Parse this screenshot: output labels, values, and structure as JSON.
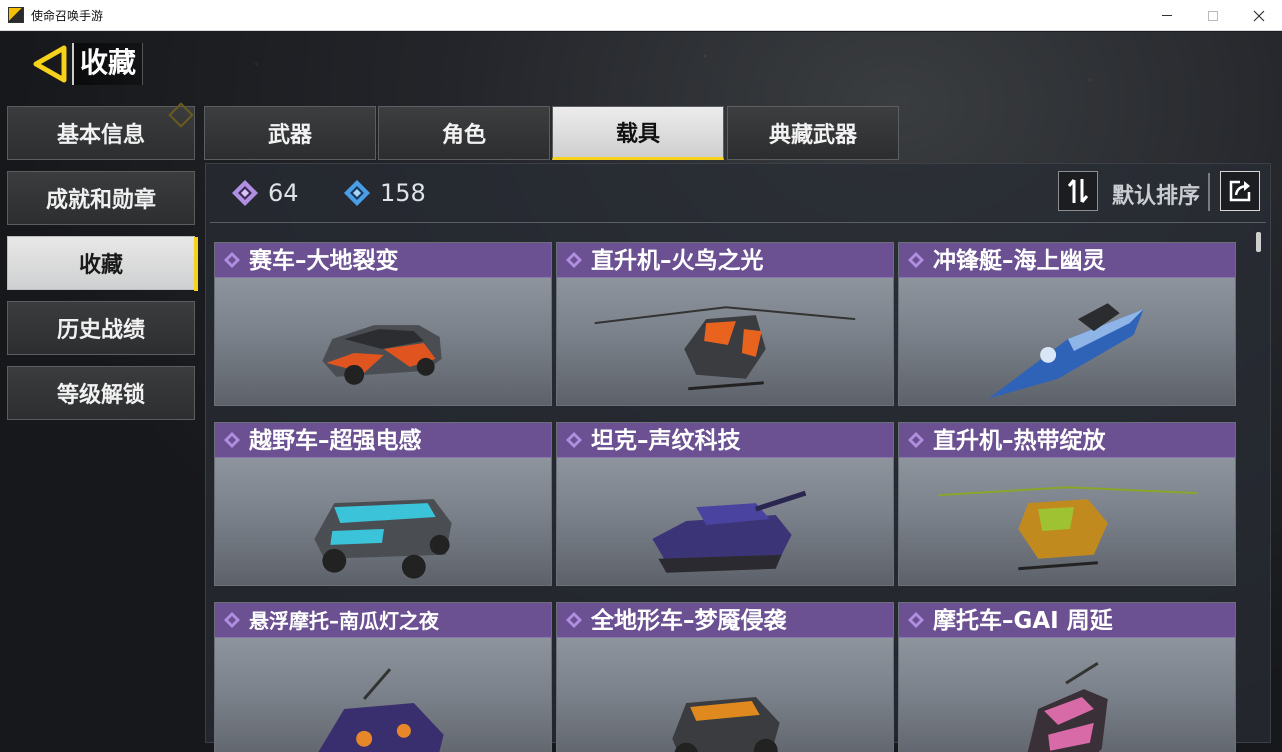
{
  "window": {
    "title": "使命召唤手游"
  },
  "header": {
    "title": "收藏"
  },
  "sidebar": {
    "items": [
      {
        "label": "基本信息"
      },
      {
        "label": "成就和勋章"
      },
      {
        "label": "收藏"
      },
      {
        "label": "历史战绩"
      },
      {
        "label": "等级解锁"
      }
    ],
    "active_index": 2
  },
  "tabs": {
    "items": [
      {
        "label": "武器"
      },
      {
        "label": "角色"
      },
      {
        "label": "载具"
      },
      {
        "label": "典藏武器"
      }
    ],
    "active_index": 2
  },
  "stats": {
    "purple_count": "64",
    "blue_count": "158"
  },
  "toolbar": {
    "sort_label": "默认排序",
    "sort_icon": "sort-updown-icon",
    "share_icon": "share-icon"
  },
  "colors": {
    "accent_yellow": "#f6d21b",
    "card_header_purple": "#6b5192",
    "rarity_purple": "#b08ee0",
    "rarity_blue": "#4a9ee8"
  },
  "cards": [
    {
      "title": "赛车–大地裂变",
      "art": "race-car-icon"
    },
    {
      "title": "直升机–火鸟之光",
      "art": "helicopter-icon"
    },
    {
      "title": "冲锋艇–海上幽灵",
      "art": "speedboat-icon"
    },
    {
      "title": "越野车–超强电感",
      "art": "offroad-car-icon"
    },
    {
      "title": "坦克–声纹科技",
      "art": "tank-icon"
    },
    {
      "title": "直升机–热带绽放",
      "art": "helicopter-icon"
    },
    {
      "title": "悬浮摩托–南瓜灯之夜",
      "art": "hover-bike-icon"
    },
    {
      "title": "全地形车–梦魇侵袭",
      "art": "atv-icon"
    },
    {
      "title": "摩托车–GAI 周延",
      "art": "motorcycle-icon"
    }
  ]
}
